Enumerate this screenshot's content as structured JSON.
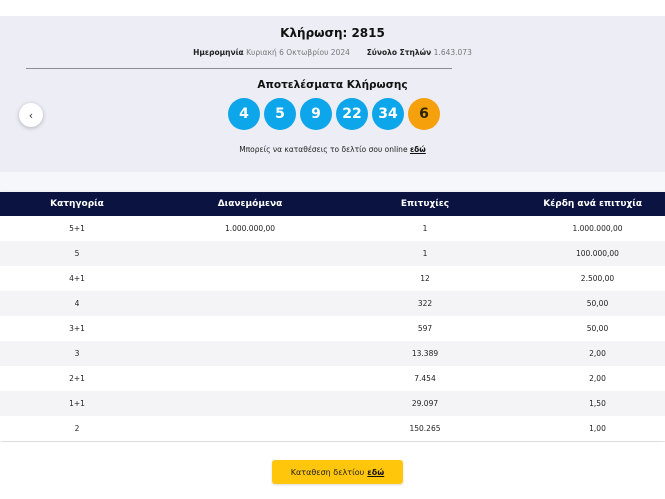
{
  "draw": {
    "title": "Κλήρωση: 2815",
    "date_label": "Ημερομηνία",
    "date_value": "Κυριακή 6 Οκτωβρίου 2024",
    "columns_label": "Σύνολο Στηλών",
    "columns_value": "1.643.073"
  },
  "results": {
    "title": "Αποτελέσματα Κλήρωσης",
    "numbers": [
      "4",
      "5",
      "9",
      "22",
      "34"
    ],
    "bonus": "6",
    "colors": {
      "main_ball": "#0ea6ea",
      "bonus_ball": "#f6a00c"
    }
  },
  "nav": {
    "prev_icon": "chevron-left-icon",
    "prev_glyph": "‹"
  },
  "bet_note": {
    "text": "Μπορείς να καταθέσεις το δελτίο σου online",
    "link": "εδώ"
  },
  "table": {
    "headers": [
      "Κατηγορία",
      "Διανεμόμενα",
      "Επιτυχίες",
      "Κέρδη ανά επιτυχία"
    ],
    "rows": [
      [
        "5+1",
        "1.000.000,00",
        "1",
        "1.000.000,00"
      ],
      [
        "5",
        "",
        "1",
        "100.000,00"
      ],
      [
        "4+1",
        "",
        "12",
        "2.500,00"
      ],
      [
        "4",
        "",
        "322",
        "50,00"
      ],
      [
        "3+1",
        "",
        "597",
        "50,00"
      ],
      [
        "3",
        "",
        "13.389",
        "2,00"
      ],
      [
        "2+1",
        "",
        "7.454",
        "2,00"
      ],
      [
        "1+1",
        "",
        "29.097",
        "1,50"
      ],
      [
        "2",
        "",
        "150.265",
        "1,00"
      ]
    ],
    "colors": {
      "header_bg": "#0b1340"
    }
  },
  "cta": {
    "text": "Καταθεση δελτίου",
    "link": "εδώ",
    "color": "#ffc60b"
  }
}
